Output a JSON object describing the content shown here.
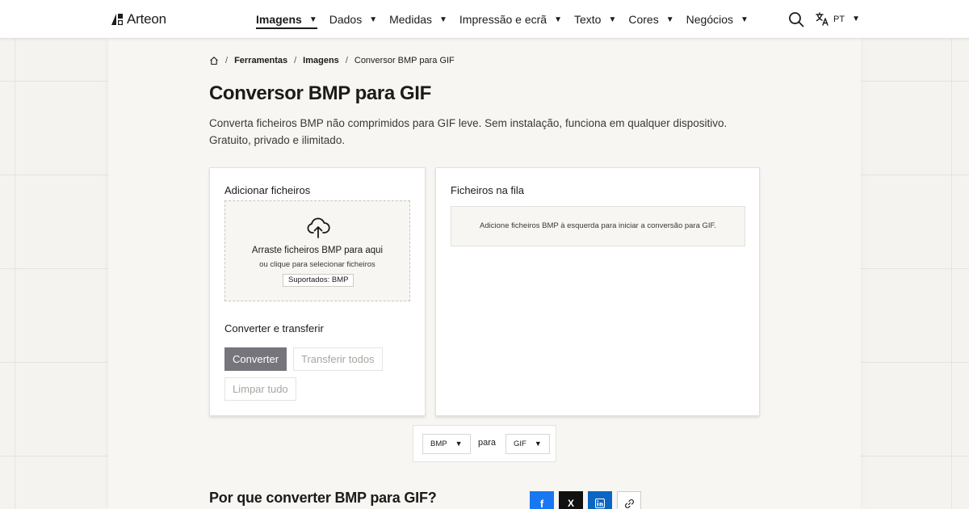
{
  "header": {
    "brand": "Arteon",
    "nav": [
      {
        "label": "Imagens",
        "active": true
      },
      {
        "label": "Dados"
      },
      {
        "label": "Medidas"
      },
      {
        "label": "Impressão e ecrã"
      },
      {
        "label": "Texto"
      },
      {
        "label": "Cores"
      },
      {
        "label": "Negócios"
      }
    ],
    "language": "PT",
    "icons": {
      "search": "search-icon",
      "translate": "translate-icon",
      "caret": "▼"
    }
  },
  "breadcrumb": {
    "items": [
      "Ferramentas",
      "Imagens"
    ],
    "current": "Conversor BMP para GIF",
    "separator": "/"
  },
  "page": {
    "title": "Conversor BMP para GIF",
    "description": "Converta ficheiros BMP não comprimidos para GIF leve. Sem instalação, funciona em qualquer dispositivo. Gratuito, privado e ilimitado."
  },
  "upload": {
    "title": "Adicionar ficheiros",
    "drop_title": "Arraste ficheiros BMP para aqui",
    "drop_sub": "ou clique para selecionar ficheiros",
    "supported": "Suportados: BMP"
  },
  "actions": {
    "title": "Converter e transferir",
    "convert": "Converter",
    "download_all": "Transferir todos",
    "clear_all": "Limpar tudo"
  },
  "queue": {
    "title": "Ficheiros na fila",
    "empty": "Adicione ficheiros BMP à esquerda para iniciar a conversão para GIF."
  },
  "format": {
    "from": "BMP",
    "to": "GIF",
    "connector": "para"
  },
  "why": {
    "title": "Por que converter BMP para GIF?"
  },
  "share": {
    "facebook": "f",
    "twitter": "X"
  },
  "colors": {
    "accent_button": "#76757b",
    "facebook": "#1877f2",
    "twitter": "#111111",
    "linkedin": "#0a66c2"
  }
}
